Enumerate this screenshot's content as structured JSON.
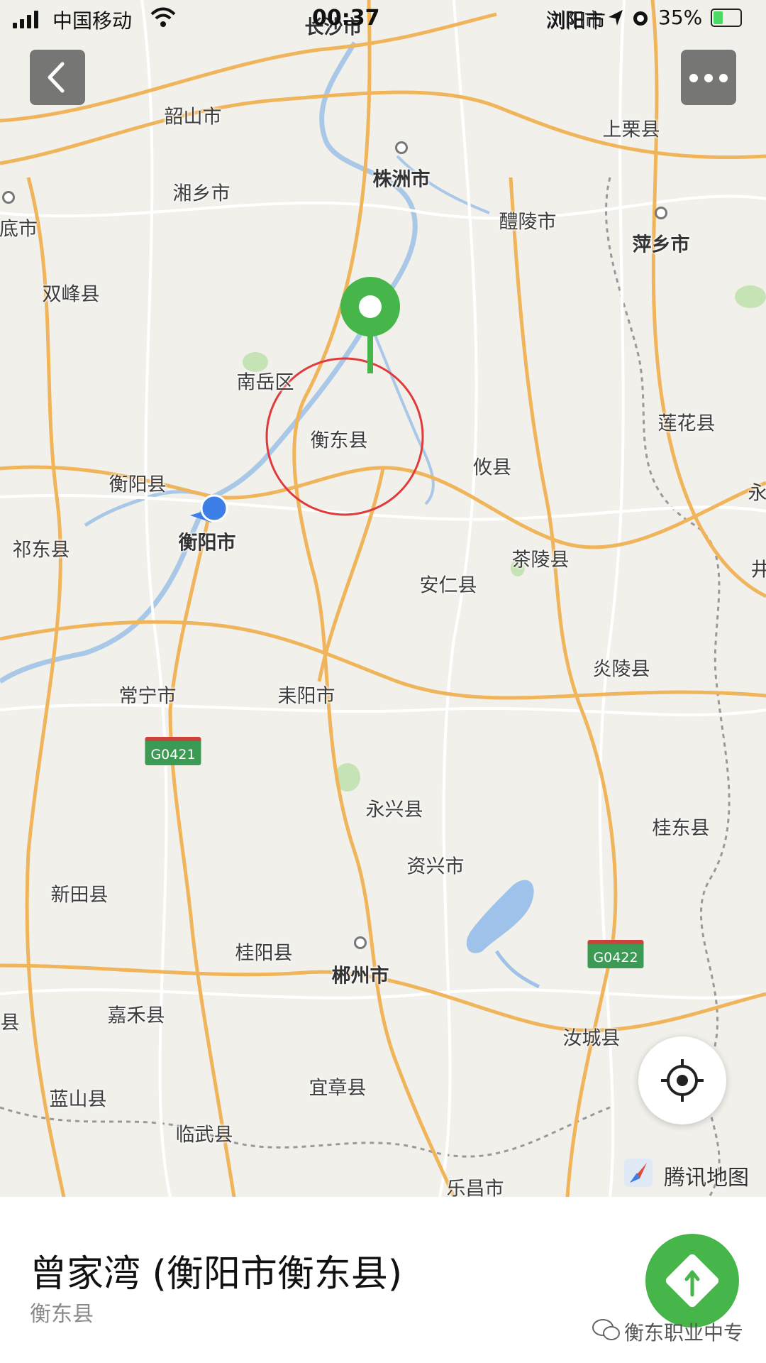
{
  "status_bar": {
    "carrier": "中国移动",
    "time": "00:37",
    "location": "浏阳市",
    "battery": "35%",
    "battery_level": 0.35
  },
  "map": {
    "provider": "腾讯地图",
    "places": [
      {
        "name": "长沙市",
        "type": "city"
      },
      {
        "name": "浏阳市",
        "type": "city"
      },
      {
        "name": "韶山市",
        "type": "town"
      },
      {
        "name": "上栗县",
        "type": "town"
      },
      {
        "name": "株洲市",
        "type": "city"
      },
      {
        "name": "湘乡市",
        "type": "town"
      },
      {
        "name": "底市",
        "type": "town"
      },
      {
        "name": "醴陵市",
        "type": "town"
      },
      {
        "name": "萍乡市",
        "type": "city"
      },
      {
        "name": "双峰县",
        "type": "town"
      },
      {
        "name": "南岳区",
        "type": "town"
      },
      {
        "name": "衡东县",
        "type": "town"
      },
      {
        "name": "莲花县",
        "type": "town"
      },
      {
        "name": "攸县",
        "type": "town"
      },
      {
        "name": "衡阳县",
        "type": "town"
      },
      {
        "name": "衡阳市",
        "type": "city"
      },
      {
        "name": "祁东县",
        "type": "town"
      },
      {
        "name": "茶陵县",
        "type": "town"
      },
      {
        "name": "安仁县",
        "type": "town"
      },
      {
        "name": "炎陵县",
        "type": "town"
      },
      {
        "name": "常宁市",
        "type": "town"
      },
      {
        "name": "耒阳市",
        "type": "town"
      },
      {
        "name": "永兴县",
        "type": "town"
      },
      {
        "name": "桂东县",
        "type": "town"
      },
      {
        "name": "资兴市",
        "type": "town"
      },
      {
        "name": "新田县",
        "type": "town"
      },
      {
        "name": "桂阳县",
        "type": "town"
      },
      {
        "name": "郴州市",
        "type": "city"
      },
      {
        "name": "嘉禾县",
        "type": "town"
      },
      {
        "name": "汝城县",
        "type": "town"
      },
      {
        "name": "蓝山县",
        "type": "town"
      },
      {
        "name": "宜章县",
        "type": "town"
      },
      {
        "name": "临武县",
        "type": "town"
      },
      {
        "name": "乐昌市",
        "type": "town"
      },
      {
        "name": "县",
        "type": "town"
      },
      {
        "name": "永",
        "type": "town"
      },
      {
        "name": "井",
        "type": "town"
      }
    ],
    "highways": [
      "G0421",
      "G0422"
    ],
    "colors": {
      "road": "#f0b45a",
      "minor_road": "#ffffff",
      "water": "#a9c8e8",
      "park": "#c5e3b5",
      "marker": "#46b64a",
      "highlight_circle": "#e03a3a",
      "user_location": "#3d7fe6"
    }
  },
  "place_card": {
    "title": "曾家湾 (衡阳市衡东县)",
    "subtitle": "衡东县"
  },
  "watermark": "衡东职业中专",
  "icons": {
    "back": "chevron-left-icon",
    "more": "more-dots-icon",
    "locate": "crosshair-icon",
    "navigate": "navigation-arrow-icon"
  }
}
